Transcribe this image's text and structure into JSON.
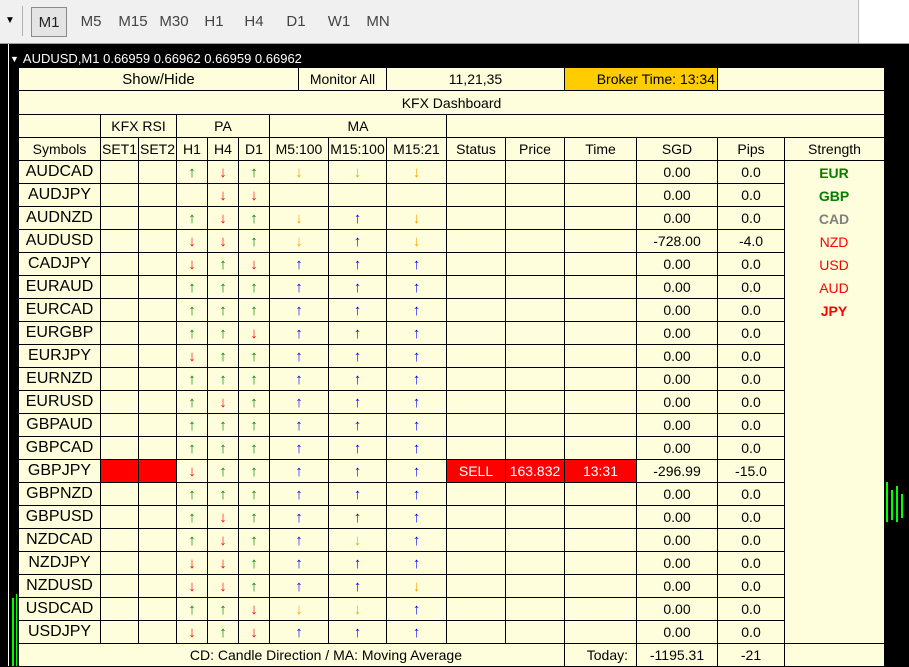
{
  "toolbar": {
    "timeframes": [
      "M1",
      "M5",
      "M15",
      "M30",
      "H1",
      "H4",
      "D1",
      "W1",
      "MN"
    ],
    "active": "M1"
  },
  "chart": {
    "symbol_line": "AUDUSD,M1  0.66959 0.66962 0.66959 0.66962"
  },
  "dashboard": {
    "show_hide": "Show/Hide",
    "monitor_all": "Monitor All",
    "periods": "11,21,35",
    "broker_time": "Broker Time: 13:34",
    "title": "KFX Dashboard",
    "group_rsi": "KFX RSI",
    "group_pa": "PA",
    "group_ma": "MA",
    "columns": {
      "symbols": "Symbols",
      "set1": "SET1",
      "set2": "SET2",
      "h1": "H1",
      "h4": "H4",
      "d1": "D1",
      "m5": "M5:100",
      "m15": "M15:100",
      "m15b": "M15:21",
      "status": "Status",
      "price": "Price",
      "time": "Time",
      "sgd": "SGD",
      "pips": "Pips",
      "strength": "Strength"
    },
    "rows": [
      {
        "symbol": "AUDCAD",
        "h1": "up",
        "h4": "down",
        "d1": "up",
        "m5": "down",
        "m15": "down",
        "m15b": "down",
        "sgd": "0.00",
        "pips": "0.0"
      },
      {
        "symbol": "AUDJPY",
        "h1": "",
        "h4": "down",
        "d1": "down",
        "m5": "",
        "m15": "",
        "m15b": "",
        "sgd": "0.00",
        "pips": "0.0"
      },
      {
        "symbol": "AUDNZD",
        "h1": "up",
        "h4": "down",
        "d1": "up",
        "m5": "down",
        "m15": "up",
        "m15b": "down",
        "sgd": "0.00",
        "pips": "0.0"
      },
      {
        "symbol": "AUDUSD",
        "h1": "down",
        "h4": "down",
        "d1": "up",
        "m5": "down",
        "m15": "up",
        "m15b": "down",
        "sgd": "-728.00",
        "pips": "-4.0"
      },
      {
        "symbol": "CADJPY",
        "h1": "down",
        "h4": "up",
        "d1": "down",
        "m5": "up",
        "m15": "up",
        "m15b": "up",
        "sgd": "0.00",
        "pips": "0.0"
      },
      {
        "symbol": "EURAUD",
        "h1": "up",
        "h4": "up",
        "d1": "up",
        "m5": "up",
        "m15": "up",
        "m15b": "up",
        "sgd": "0.00",
        "pips": "0.0"
      },
      {
        "symbol": "EURCAD",
        "h1": "up",
        "h4": "up",
        "d1": "up",
        "m5": "up",
        "m15": "up",
        "m15b": "up",
        "sgd": "0.00",
        "pips": "0.0"
      },
      {
        "symbol": "EURGBP",
        "h1": "up",
        "h4": "up",
        "d1": "down",
        "m5": "up",
        "m15": "up",
        "m15b": "up",
        "sgd": "0.00",
        "pips": "0.0"
      },
      {
        "symbol": "EURJPY",
        "h1": "down",
        "h4": "up",
        "d1": "up",
        "m5": "up",
        "m15": "up",
        "m15b": "up",
        "sgd": "0.00",
        "pips": "0.0"
      },
      {
        "symbol": "EURNZD",
        "h1": "up",
        "h4": "up",
        "d1": "up",
        "m5": "up",
        "m15": "up",
        "m15b": "up",
        "sgd": "0.00",
        "pips": "0.0"
      },
      {
        "symbol": "EURUSD",
        "h1": "up",
        "h4": "down",
        "d1": "up",
        "m5": "up",
        "m15": "up",
        "m15b": "up",
        "sgd": "0.00",
        "pips": "0.0"
      },
      {
        "symbol": "GBPAUD",
        "h1": "up",
        "h4": "up",
        "d1": "up",
        "m5": "up",
        "m15": "up",
        "m15b": "up",
        "sgd": "0.00",
        "pips": "0.0"
      },
      {
        "symbol": "GBPCAD",
        "h1": "up",
        "h4": "up",
        "d1": "up",
        "m5": "up",
        "m15": "up",
        "m15b": "up",
        "sgd": "0.00",
        "pips": "0.0"
      },
      {
        "symbol": "GBPJPY",
        "h1": "down",
        "h4": "up",
        "d1": "up",
        "m5": "up",
        "m15": "up",
        "m15b": "up",
        "status": "SELL",
        "price": "163.832",
        "time": "13:31",
        "sgd": "-296.99",
        "pips": "-15.0",
        "alert": true
      },
      {
        "symbol": "GBPNZD",
        "h1": "up",
        "h4": "up",
        "d1": "up",
        "m5": "up",
        "m15": "up",
        "m15b": "up",
        "sgd": "0.00",
        "pips": "0.0"
      },
      {
        "symbol": "GBPUSD",
        "h1": "up",
        "h4": "down",
        "d1": "up",
        "m5": "up",
        "m15": "up",
        "m15b": "up",
        "sgd": "0.00",
        "pips": "0.0"
      },
      {
        "symbol": "NZDCAD",
        "h1": "up",
        "h4": "down",
        "d1": "up",
        "m5": "up",
        "m15": "down",
        "m15b": "up",
        "sgd": "0.00",
        "pips": "0.0"
      },
      {
        "symbol": "NZDJPY",
        "h1": "down",
        "h4": "down",
        "d1": "up",
        "m5": "up",
        "m15": "up",
        "m15b": "up",
        "sgd": "0.00",
        "pips": "0.0"
      },
      {
        "symbol": "NZDUSD",
        "h1": "down",
        "h4": "down",
        "d1": "up",
        "m5": "up",
        "m15": "up",
        "m15b": "down",
        "sgd": "0.00",
        "pips": "0.0"
      },
      {
        "symbol": "USDCAD",
        "h1": "up",
        "h4": "up",
        "d1": "down",
        "m5": "down",
        "m15": "down",
        "m15b": "up",
        "sgd": "0.00",
        "pips": "0.0"
      },
      {
        "symbol": "USDJPY",
        "h1": "down",
        "h4": "up",
        "d1": "down",
        "m5": "up",
        "m15": "up",
        "m15b": "up",
        "sgd": "0.00",
        "pips": "0.0"
      }
    ],
    "strength": [
      {
        "label": "EUR",
        "color": "#008000",
        "bold": true
      },
      {
        "label": "GBP",
        "color": "#008000",
        "bold": true
      },
      {
        "label": "CAD",
        "color": "#808080",
        "bold": true
      },
      {
        "label": "NZD",
        "color": "#ff0000",
        "bold": false
      },
      {
        "label": "USD",
        "color": "#ff0000",
        "bold": false
      },
      {
        "label": "AUD",
        "color": "#ff0000",
        "bold": false
      },
      {
        "label": "JPY",
        "color": "#ff0000",
        "bold": true
      }
    ],
    "footer": {
      "legend": "CD: Candle Direction / MA: Moving Average",
      "today_label": "Today:",
      "total_sgd": "-1195.31",
      "total_pips": "-21"
    }
  }
}
